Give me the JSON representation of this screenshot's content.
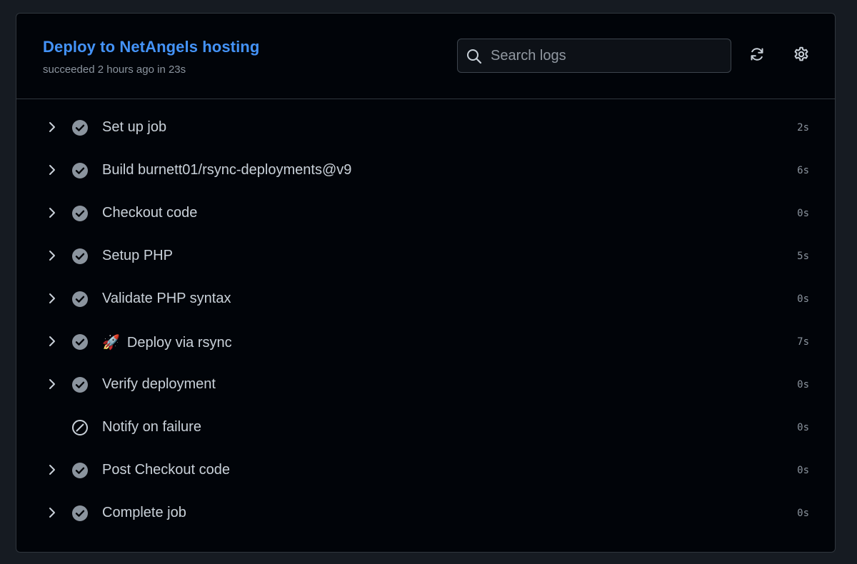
{
  "job": {
    "title": "Deploy to NetAngels hosting",
    "subtitle": "succeeded 2 hours ago in 23s"
  },
  "search": {
    "placeholder": "Search logs"
  },
  "icons": {
    "refresh": "refresh-icon",
    "settings": "gear-icon",
    "search": "search-icon",
    "success": "check-circle-fill-icon",
    "skipped": "skip-circle-icon",
    "chevron": "chevron-right-icon"
  },
  "colors": {
    "accent": "#4493f8",
    "text": "#c9d1d9",
    "muted": "#8b949e",
    "success_icon": "#8b949e",
    "background": "#010409",
    "border": "#30363d"
  },
  "steps": [
    {
      "label": "Set up job",
      "duration": "2s",
      "status": "success",
      "expandable": true
    },
    {
      "label": "Build burnett01/rsync-deployments@v9",
      "duration": "6s",
      "status": "success",
      "expandable": true
    },
    {
      "label": "Checkout code",
      "duration": "0s",
      "status": "success",
      "expandable": true
    },
    {
      "label": "Setup PHP",
      "duration": "5s",
      "status": "success",
      "expandable": true
    },
    {
      "label": "Validate PHP syntax",
      "duration": "0s",
      "status": "success",
      "expandable": true
    },
    {
      "label": "Deploy via rsync",
      "emoji": "🚀",
      "duration": "7s",
      "status": "success",
      "expandable": true
    },
    {
      "label": "Verify deployment",
      "duration": "0s",
      "status": "success",
      "expandable": true
    },
    {
      "label": "Notify on failure",
      "duration": "0s",
      "status": "skipped",
      "expandable": false
    },
    {
      "label": "Post Checkout code",
      "duration": "0s",
      "status": "success",
      "expandable": true
    },
    {
      "label": "Complete job",
      "duration": "0s",
      "status": "success",
      "expandable": true
    }
  ]
}
